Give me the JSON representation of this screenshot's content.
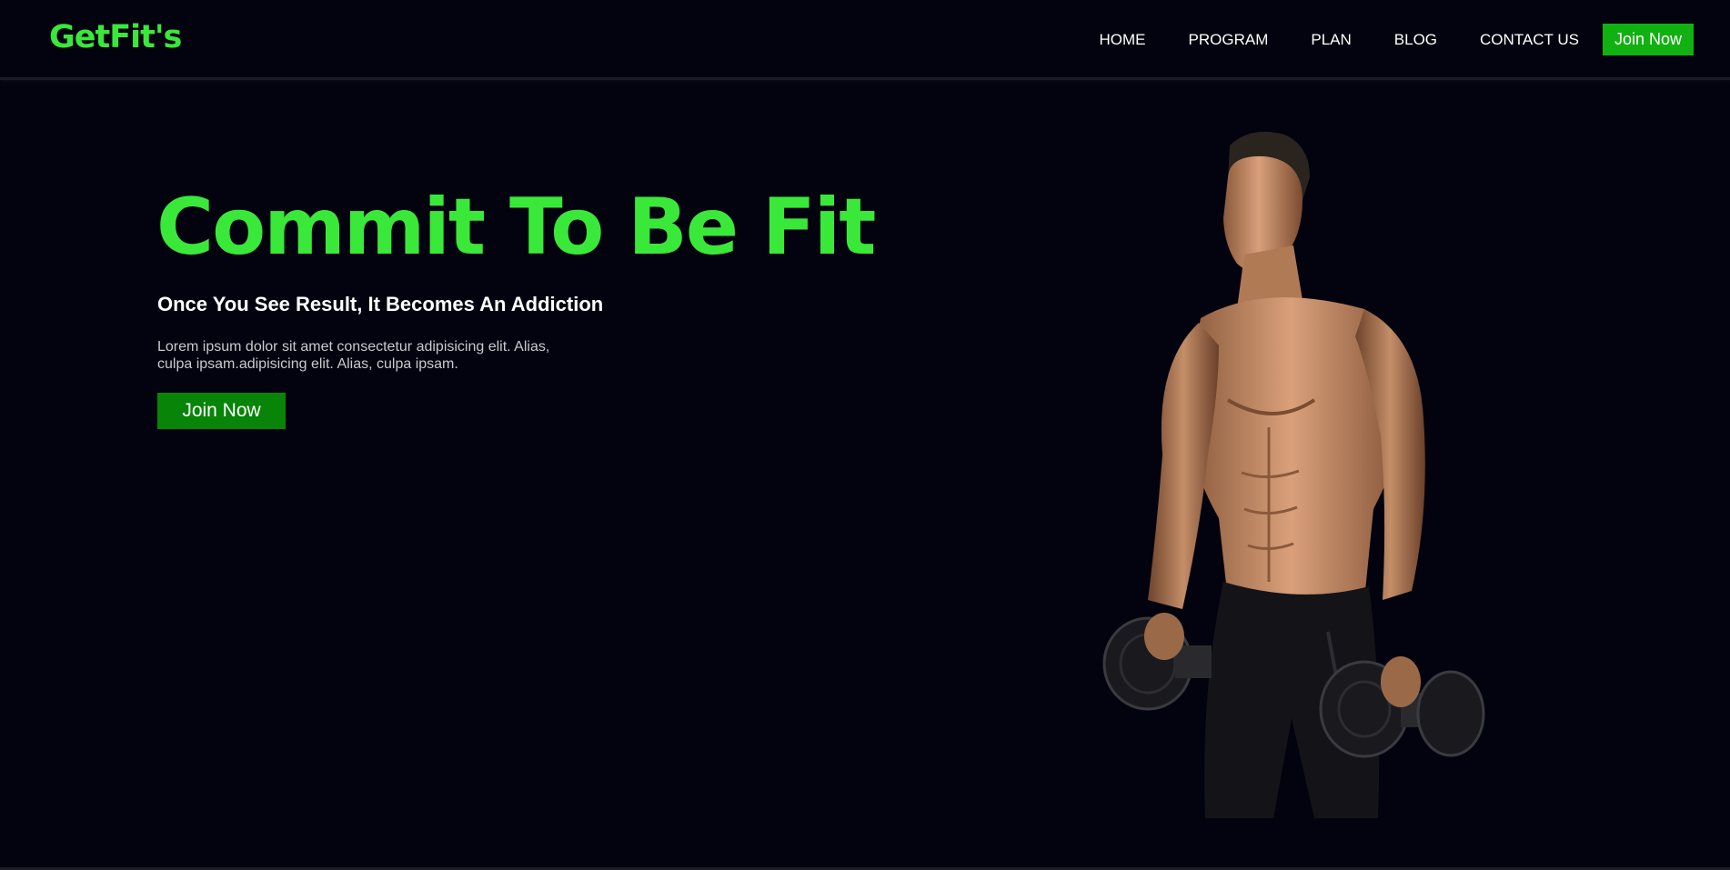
{
  "header": {
    "logo": "GetFit's",
    "nav": [
      "HOME",
      "PROGRAM",
      "PLAN",
      "BLOG",
      "CONTACT US"
    ],
    "cta_label": "Join Now"
  },
  "hero": {
    "title": "Commit To Be Fit",
    "subtitle": "Once You See Result, It Becomes An Addiction",
    "body": "Lorem ipsum dolor sit amet consectetur adipisicing elit. Alias, culpa ipsam.adipisicing elit. Alias, culpa ipsam.",
    "cta_label": "Join Now",
    "image": "fitness-model-with-dumbbells"
  },
  "colors": {
    "background": "#03030f",
    "accent": "#3ae83a",
    "button": "#088408",
    "nav_button": "#12b112"
  }
}
